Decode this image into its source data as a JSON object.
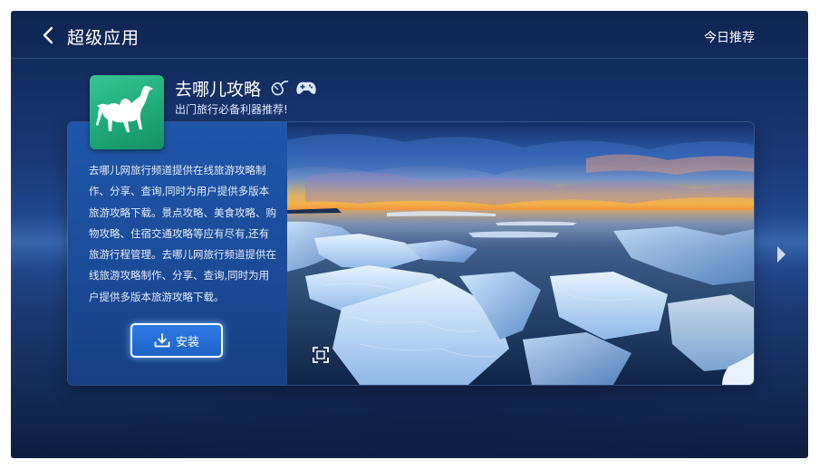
{
  "header": {
    "title": "超级应用",
    "right_link": "今日推荐"
  },
  "app": {
    "name": "去哪儿攻略",
    "slogan": "出门旅行必备利器推荐!",
    "icon": "camel-icon",
    "icon_color": "#1fa877",
    "badges": [
      "mouse-icon",
      "gamepad-icon"
    ],
    "description": "去哪儿网旅行频道提供在线旅游攻略制作、分享、查询,同时为用户提供多版本旅游攻略下载。景点攻略、美食攻略、购物攻略、住宿交通攻略等应有尽有,还有旅游行程管理。去哪儿网旅行频道提供在线旅游攻略制作、分享、查询,同时为用户提供多版本旅游攻略下载。",
    "install_label": "安装"
  },
  "accent_color": "#2e7be4"
}
